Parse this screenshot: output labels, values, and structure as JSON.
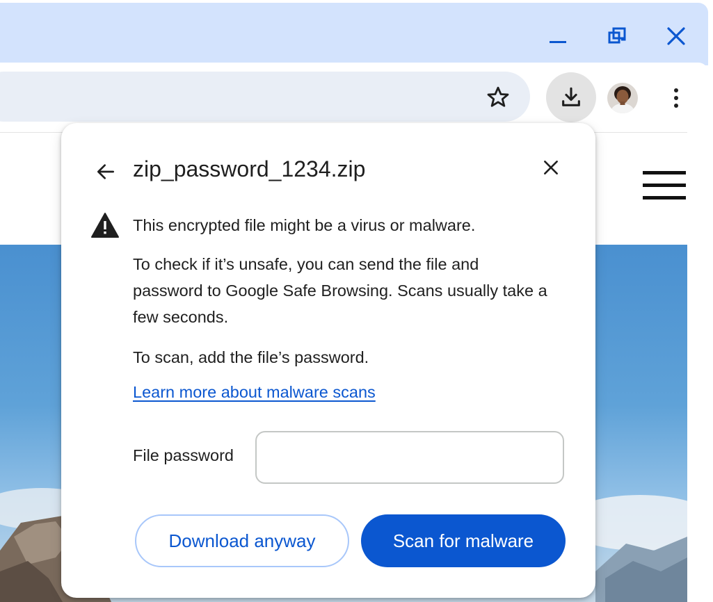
{
  "window": {
    "minimize_icon": "minimize-icon",
    "restore_icon": "restore-icon",
    "close_icon": "close-icon"
  },
  "toolbar": {
    "bookmark_icon": "star-icon",
    "download_icon": "download-icon",
    "profile_icon": "avatar",
    "menu_icon": "more-vert-icon"
  },
  "dialog": {
    "title": "zip_password_1234.zip",
    "warning": "This encrypted file might be a virus or malware.",
    "description": "To check if it’s unsafe, you can send the file and password to Google Safe Browsing. Scans usually take a few seconds.",
    "instruction": "To scan, add the file’s password.",
    "learn_more": "Learn more about malware scans",
    "password_label": "File password",
    "password_value": "",
    "download_anyway": "Download anyway",
    "scan_for_malware": "Scan for malware"
  },
  "colors": {
    "titlebar": "#d3e3fd",
    "omnibox": "#e9eef6",
    "accent": "#0b57d0",
    "secondary_border": "#a8c7fa",
    "text": "#1f1f1f"
  }
}
